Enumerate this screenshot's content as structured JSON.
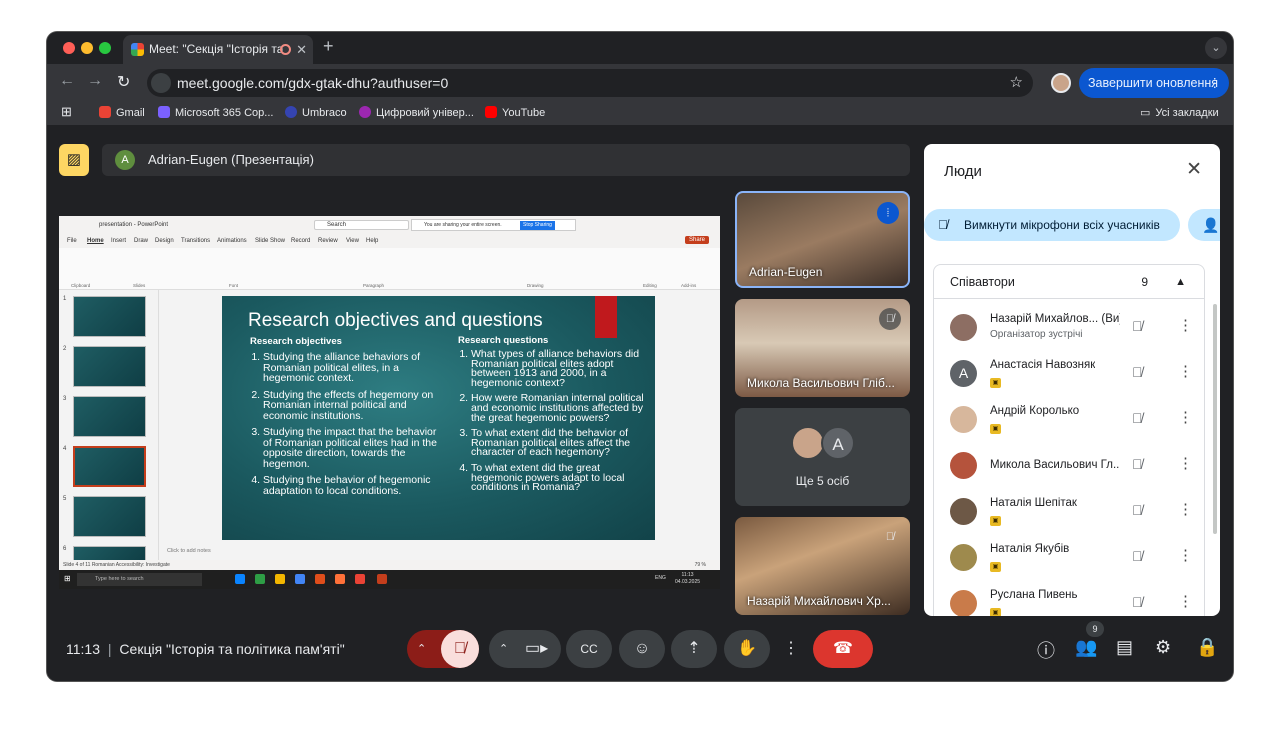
{
  "browser": {
    "tab_title": "Meet: \"Секція \"Історія та",
    "url": "meet.google.com/gdx-gtak-dhu?authuser=0",
    "update_button": "Завершити оновлення",
    "bookmarks": [
      {
        "label": "Gmail",
        "color": "#ea4335"
      },
      {
        "label": "Microsoft 365 Cop...",
        "color": "#7b61ff"
      },
      {
        "label": "Umbraco",
        "color": "#3544b1"
      },
      {
        "label": "Цифровий універ...",
        "color": "#9c27b0"
      },
      {
        "label": "YouTube",
        "color": "#ff0000"
      }
    ],
    "all_bookmarks": "Усі закладки"
  },
  "meet": {
    "presenter_label": "Adrian-Eugen (Презентація)",
    "presenter_initial": "A",
    "tiles": [
      {
        "name": "Adrian-Eugen"
      },
      {
        "name": "Микола Васильович Гліб..."
      },
      {
        "name": "Ще 5 осіб",
        "initial": "A"
      },
      {
        "name": "Назарій Михайлович Хр..."
      }
    ],
    "meeting_time": "11:13",
    "meeting_title": "Секція \"Історія та політика пам'яті\"",
    "people_count_badge": "9"
  },
  "people_panel": {
    "title": "Люди",
    "mute_all": "Вимкнути мікрофони всіх учасників",
    "section_title": "Співавтори",
    "section_count": "9",
    "participants": [
      {
        "name": "Назарій Михайлов... (Ви)",
        "subtitle": "Організатор зустрічі",
        "initial": "",
        "avatar_color": "#8d6e63"
      },
      {
        "name": "Анастасія Навозняк",
        "subtitle": "",
        "initial": "А",
        "avatar_color": "#5f6368"
      },
      {
        "name": "Андрій Королько",
        "subtitle": "",
        "initial": "",
        "avatar_color": "#d7b79c"
      },
      {
        "name": "Микола Васильович Гл...",
        "subtitle": "",
        "initial": "",
        "avatar_color": "#b5533c"
      },
      {
        "name": "Наталія Шепітак",
        "subtitle": "",
        "initial": "",
        "avatar_color": "#6d5846"
      },
      {
        "name": "Наталія Якубів",
        "subtitle": "",
        "initial": "",
        "avatar_color": "#9e8a4d"
      },
      {
        "name": "Руслана Пивень",
        "subtitle": "",
        "initial": "",
        "avatar_color": "#c97b4a"
      }
    ]
  },
  "shared_screen": {
    "app_title": "presentation - PowerPoint",
    "search_placeholder": "Search",
    "sharing_notice": "You are sharing your entire screen.",
    "stop_sharing": "Stop Sharing",
    "menu": [
      "File",
      "Home",
      "Insert",
      "Draw",
      "Design",
      "Transitions",
      "Animations",
      "Slide Show",
      "Record",
      "Review",
      "View",
      "Help"
    ],
    "share_btn": "Share",
    "ribbon_groups": [
      "Clipboard",
      "Slides",
      "Font",
      "Paragraph",
      "Drawing",
      "Editing",
      "Add-ins"
    ],
    "slide": {
      "title": "Research objectives and questions",
      "left_heading": "Research objectives",
      "left_items": [
        "Studying the alliance behaviors of Romanian political elites, in a hegemonic context.",
        "Studying the effects of hegemony on Romanian internal political and economic institutions.",
        "Studying the impact that the behavior of Romanian political elites had in the opposite direction, towards the hegemon.",
        "Studying the behavior of hegemonic adaptation to local conditions."
      ],
      "right_heading": "Research questions",
      "right_items": [
        "What types of alliance behaviors did Romanian political elites adopt between 1913 and 2000, in a hegemonic context?",
        "How were Romanian internal political and economic institutions affected by the great hegemonic powers?",
        "To what extent did the behavior of Romanian political elites affect the character of each hegemony?",
        "To what extent did the great hegemonic powers adapt to local conditions in Romania?"
      ]
    },
    "notes_placeholder": "Click to add notes",
    "status": "Slide 4 of 11   Romanian   Accessibility: Investigate",
    "taskbar_search": "Type here to search",
    "taskbar_time": "11:13",
    "taskbar_date": "04.03.2025",
    "taskbar_lang": "ENG",
    "zoom": "79 %"
  }
}
